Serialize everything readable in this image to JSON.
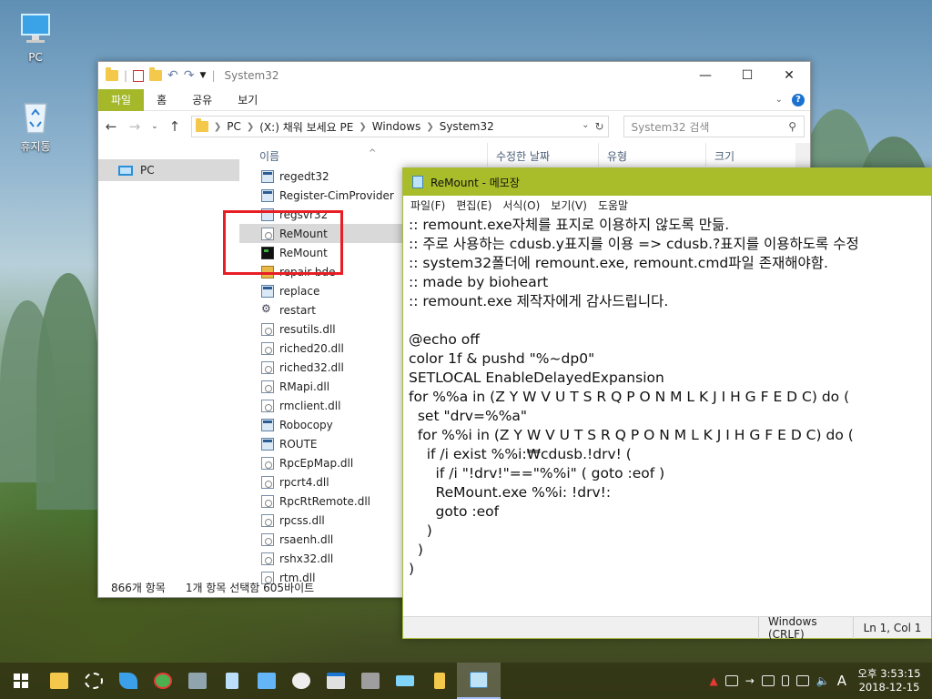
{
  "desktop": {
    "icons": [
      {
        "label": "PC"
      },
      {
        "label": "휴지통"
      }
    ]
  },
  "explorer": {
    "title": "System32",
    "ribbon_tabs": [
      "파일",
      "홈",
      "공유",
      "보기"
    ],
    "address": [
      "PC",
      "(X:) 채워 보세요 PE",
      "Windows",
      "System32"
    ],
    "search_placeholder": "System32 검색",
    "nav_items": [
      {
        "label": "PC"
      }
    ],
    "columns": [
      "이름",
      "수정한 날짜",
      "유형",
      "크기"
    ],
    "files": [
      {
        "name": "regedt32",
        "icon": "app-icon"
      },
      {
        "name": "Register-CimProvider",
        "icon": "app-icon"
      },
      {
        "name": "regsvr32",
        "icon": "app-icon"
      },
      {
        "name": "ReMount",
        "icon": "cmd-icon",
        "selected": true
      },
      {
        "name": "ReMount",
        "icon": "exe-icon"
      },
      {
        "name": "repair-bde",
        "icon": "multi-icon"
      },
      {
        "name": "replace",
        "icon": "app-icon"
      },
      {
        "name": "restart",
        "icon": "gear-icon"
      },
      {
        "name": "resutils.dll",
        "icon": "dll-icon"
      },
      {
        "name": "riched20.dll",
        "icon": "dll-icon"
      },
      {
        "name": "riched32.dll",
        "icon": "dll-icon"
      },
      {
        "name": "RMapi.dll",
        "icon": "dll-icon"
      },
      {
        "name": "rmclient.dll",
        "icon": "dll-icon"
      },
      {
        "name": "Robocopy",
        "icon": "app-icon"
      },
      {
        "name": "ROUTE",
        "icon": "app-icon"
      },
      {
        "name": "RpcEpMap.dll",
        "icon": "dll-icon"
      },
      {
        "name": "rpcrt4.dll",
        "icon": "dll-icon"
      },
      {
        "name": "RpcRtRemote.dll",
        "icon": "dll-icon"
      },
      {
        "name": "rpcss.dll",
        "icon": "dll-icon"
      },
      {
        "name": "rsaenh.dll",
        "icon": "dll-icon"
      },
      {
        "name": "rshx32.dll",
        "icon": "dll-icon"
      },
      {
        "name": "rtm.dll",
        "icon": "dll-icon"
      }
    ],
    "status": {
      "count": "866개 항목",
      "selection": "1개 항목 선택함 605바이트"
    }
  },
  "notepad": {
    "title": "ReMount - 메모장",
    "menu": [
      "파일(F)",
      "편집(E)",
      "서식(O)",
      "보기(V)",
      "도움말"
    ],
    "content": ":: remount.exe자체를 표지로 이용하지 않도록 만듦.\n:: 주로 사용하는 cdusb.y표지를 이용 => cdusb.?표지를 이용하도록 수정\n:: system32폴더에 remount.exe, remount.cmd파일 존재해야함.\n:: made by bioheart\n:: remount.exe 제작자에게 감사드립니다.\n\n@echo off\ncolor 1f & pushd \"%~dp0\"\nSETLOCAL EnableDelayedExpansion\nfor %%a in (Z Y W V U T S R Q P O N M L K J I H G F E D C) do (\n  set \"drv=%%a\"\n  for %%i in (Z Y W V U T S R Q P O N M L K J I H G F E D C) do (\n    if /i exist %%i:₩cdusb.!drv! (\n      if /i \"!drv!\"==\"%%i\" ( goto :eof )\n      ReMount.exe %%i: !drv!:\n      goto :eof\n    )\n  )\n)",
    "status": {
      "encoding": "Windows (CRLF)",
      "position": "Ln 1, Col 1"
    }
  },
  "taskbar": {
    "clock_time": "오후 3:53:15",
    "clock_date": "2018-12-15",
    "ime": "A"
  }
}
